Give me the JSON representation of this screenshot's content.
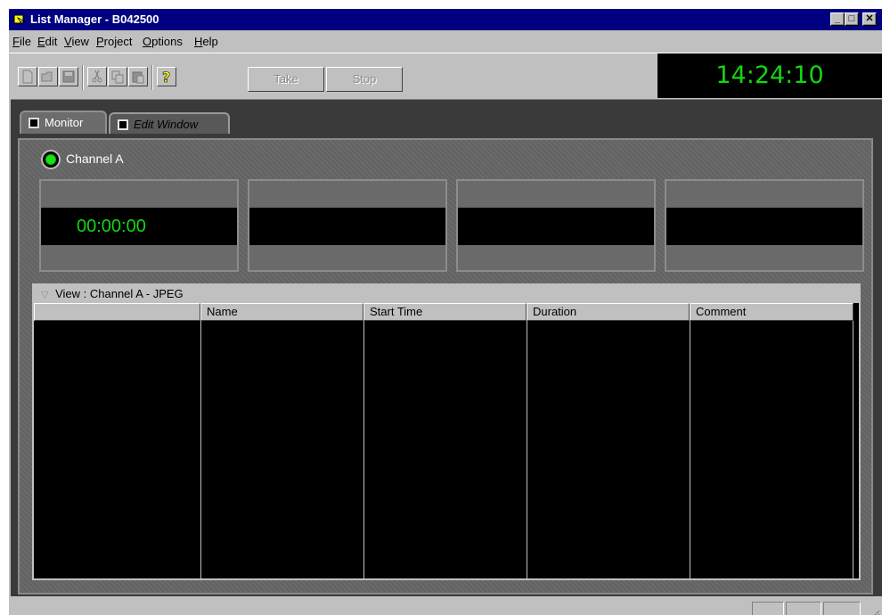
{
  "window": {
    "title": "List Manager - B042500"
  },
  "menu": [
    "File",
    "Edit",
    "View",
    "Project",
    "Options",
    "Help"
  ],
  "menu_mnemonics": [
    "F",
    "E",
    "V",
    "P",
    "O",
    "H"
  ],
  "toolbar": {
    "take_label": "Take",
    "stop_label": "Stop",
    "clock": "14:24:10"
  },
  "tabs": {
    "monitor": "Monitor",
    "edit_window": "Edit Window"
  },
  "channel": {
    "label": "Channel A",
    "timecode": "00:00:00"
  },
  "list": {
    "view_title": "View : Channel A - JPEG",
    "columns": [
      "",
      "Name",
      "Start Time",
      "Duration",
      "Comment"
    ]
  },
  "colors": {
    "title_bar": "#000080",
    "clock_text": "#13d613",
    "led": "#19e219"
  }
}
